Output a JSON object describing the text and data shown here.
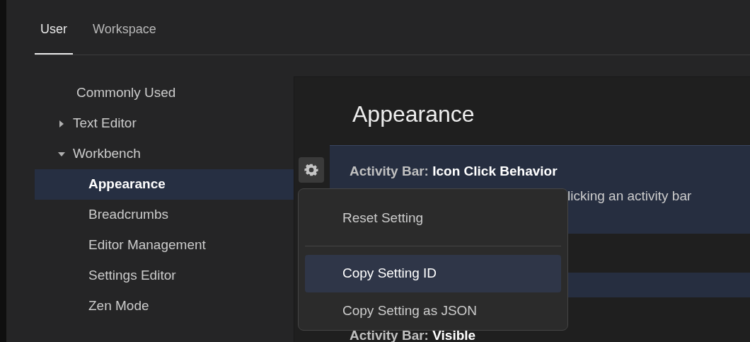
{
  "tabs": [
    {
      "label": "User",
      "selected": true
    },
    {
      "label": "Workspace",
      "selected": false
    }
  ],
  "tree": [
    {
      "label": "Commonly Used",
      "selected": false
    },
    {
      "label": "Text Editor",
      "expanded": false,
      "selected": false
    },
    {
      "label": "Workbench",
      "expanded": true,
      "selected": false,
      "children": [
        {
          "label": "Appearance",
          "selected": true
        },
        {
          "label": "Breadcrumbs",
          "selected": false
        },
        {
          "label": "Editor Management",
          "selected": false
        },
        {
          "label": "Settings Editor",
          "selected": false
        },
        {
          "label": "Zen Mode",
          "selected": false
        }
      ]
    }
  ],
  "section_title": "Appearance",
  "settings": [
    {
      "category": "Activity Bar: ",
      "name": "Icon Click Behavior",
      "description": "licking an activity bar",
      "focused": true
    },
    {
      "category": "Activity Bar: ",
      "name": "Visible",
      "focused": false
    }
  ],
  "context_menu": [
    {
      "kind": "item",
      "label": "Reset Setting",
      "selected": false
    },
    {
      "kind": "separator"
    },
    {
      "kind": "item",
      "label": "Copy Setting ID",
      "selected": true
    },
    {
      "kind": "item",
      "label": "Copy Setting as JSON",
      "selected": false
    }
  ]
}
